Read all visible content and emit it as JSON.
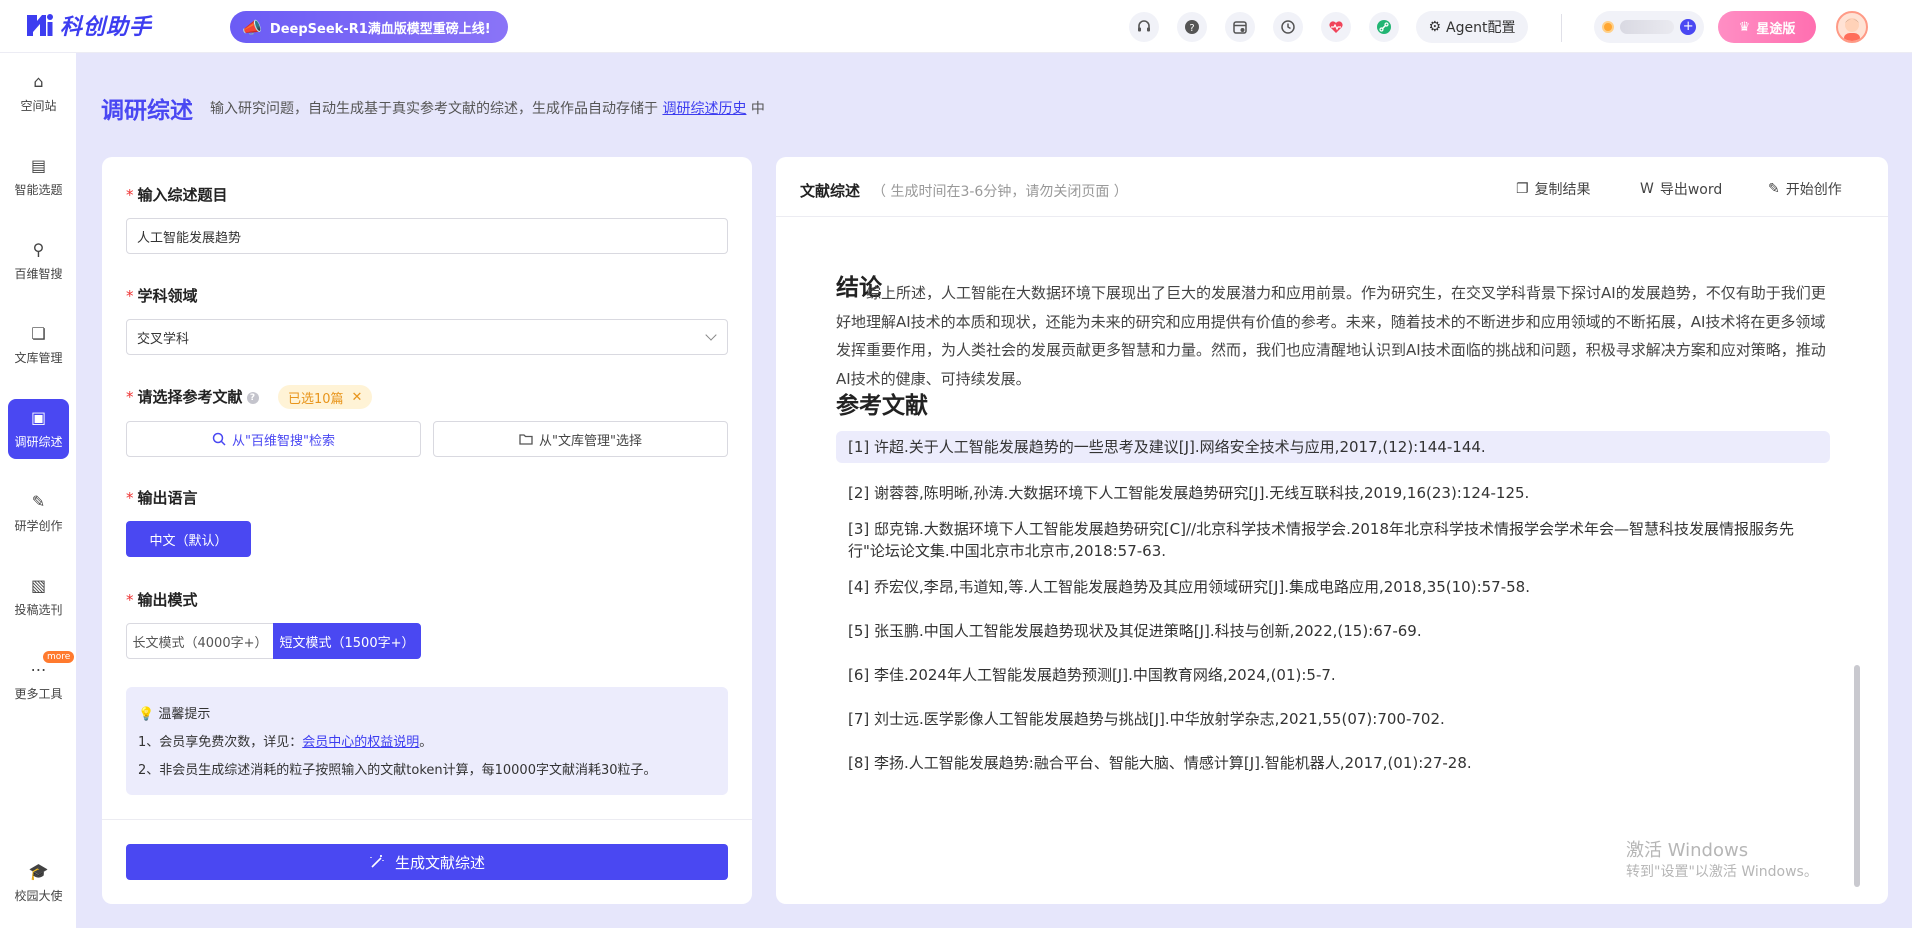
{
  "app": {
    "logo_text": "科创助手",
    "promo": "DeepSeek-R1满血版模型重磅上线!",
    "agent_btn": "Agent配置",
    "vip_btn": "星途版",
    "brand_color": "#4a48f2"
  },
  "toolbar_icons": [
    "headset-icon",
    "help-icon",
    "calendar-icon",
    "history-icon",
    "heart-icon",
    "link-icon"
  ],
  "sidebar": {
    "items": [
      {
        "label": "空间站",
        "icon": "⌂"
      },
      {
        "label": "智能选题",
        "icon": "▤"
      },
      {
        "label": "百维智搜",
        "icon": "⚲"
      },
      {
        "label": "文库管理",
        "icon": "❏"
      },
      {
        "label": "调研综述",
        "icon": "▣"
      },
      {
        "label": "研学创作",
        "icon": "✎"
      },
      {
        "label": "投稿选刊",
        "icon": "▧"
      },
      {
        "label": "更多工具",
        "icon": "⋯"
      }
    ],
    "more_badge": "more",
    "bottom_label": "校园大使"
  },
  "page": {
    "title": "调研综述",
    "desc_prefix": "输入研究问题，自动生成基于真实参考文献的综述，生成作品自动存储于",
    "desc_link": "调研综述历史",
    "desc_suffix": "中"
  },
  "form": {
    "topic_label": "输入综述题目",
    "topic_value": "人工智能发展趋势",
    "field_label": "学科领域",
    "field_value": "交叉学科",
    "refs_label": "请选择参考文献",
    "refs_selected": "已选10篇",
    "refs_btn_search": "从\"百维智搜\"检索",
    "refs_btn_library": "从\"文库管理\"选择",
    "lang_label": "输出语言",
    "lang_value": "中文（默认）",
    "mode_label": "输出模式",
    "mode_long": "长文模式（4000字+）",
    "mode_short": "短文模式（1500字+）",
    "tips_title": "温馨提示",
    "tip1_prefix": "1、会员享免费次数，详见：",
    "tip1_link": "会员中心的权益说明",
    "tip1_suffix": "。",
    "tip2": "2、非会员生成综述消耗的粒子按照输入的文献token计算，每10000字文献消耗30粒子。",
    "generate_btn": "生成文献综述"
  },
  "result": {
    "title": "文献综述",
    "subtitle": "（ 生成时间在3-6分钟，请勿关闭页面 ）",
    "copy": "复制结果",
    "export": "导出word",
    "create": "开始创作",
    "conclusion_title": "结论",
    "conclusion_text": "综上所述，人工智能在大数据环境下展现出了巨大的发展潜力和应用前景。作为研究生，在交叉学科背景下探讨AI的发展趋势，不仅有助于我们更好地理解AI技术的本质和现状，还能为未来的研究和应用提供有价值的参考。未来，随着技术的不断进步和应用领域的不断拓展，AI技术将在更多领域发挥重要作用，为人类社会的发展贡献更多智慧和力量。然而，我们也应清醒地认识到AI技术面临的挑战和问题，积极寻求解决方案和应对策略，推动AI技术的健康、可持续发展。",
    "refs_title": "参考文献",
    "refs": [
      "[1] 许超.关于人工智能发展趋势的一些思考及建议[J].网络安全技术与应用,2017,(12):144-144.",
      "[2] 谢蓉蓉,陈明晰,孙涛.大数据环境下人工智能发展趋势研究[J].无线互联科技,2019,16(23):124-125.",
      "[3] 邸克锦.大数据环境下人工智能发展趋势研究[C]//北京科学技术情报学会.2018年北京科学技术情报学会学术年会—智慧科技发展情报服务先行\"论坛论文集.中国北京市北京市,2018:57-63.",
      "[4] 乔宏仪,李昂,韦道知,等.人工智能发展趋势及其应用领域研究[J].集成电路应用,2018,35(10):57-58.",
      "[5] 张玉鹏.中国人工智能发展趋势现状及其促进策略[J].科技与创新,2022,(15):67-69.",
      "[6] 李佳.2024年人工智能发展趋势预测[J].中国教育网络,2024,(01):5-7.",
      "[7] 刘士远.医学影像人工智能发展趋势与挑战[J].中华放射学杂志,2021,55(07):700-702.",
      "[8] 李扬.人工智能发展趋势:融合平台、智能大脑、情感计算[J].智能机器人,2017,(01):27-28."
    ]
  },
  "watermark": {
    "line1": "激活 Windows",
    "line2": "转到\"设置\"以激活 Windows。"
  }
}
